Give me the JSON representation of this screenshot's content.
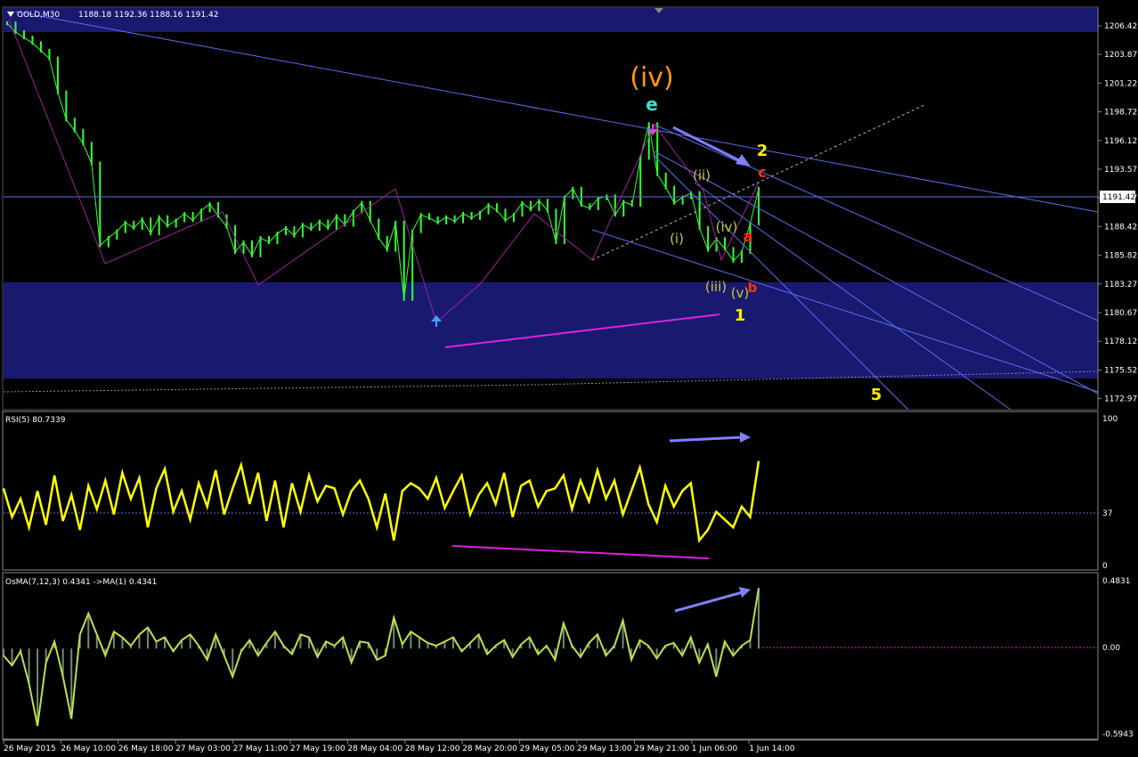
{
  "header": {
    "symbol": "GOLD,M30",
    "ohlc": "1188.18 1192.36 1188.16 1191.42"
  },
  "colors": {
    "background": "#000000",
    "zone": "#191970",
    "trendline": "#5a6cf0",
    "candle": "#33ff33",
    "rsi": "#ffff00",
    "osma_line": "#bfe04a",
    "osma_hist": "#6f8b73",
    "divergence": "#e020e0",
    "arrow": "#8080ff",
    "wave_orange": "#ff9900",
    "wave_cyan": "#40e0d0",
    "wave_olive": "#c8c83c",
    "wave_yellow": "#ffee00",
    "wave_red": "#ff3300"
  },
  "price_axis": {
    "labels": [
      "1206.42",
      "1203.87",
      "1201.22",
      "1198.72",
      "1196.12",
      "1193.57",
      "1190.97",
      "1188.42",
      "1185.82",
      "1183.27",
      "1180.67",
      "1178.12",
      "1175.52",
      "1172.97"
    ],
    "current": "1191.42"
  },
  "time_axis": {
    "labels": [
      "26 May 2015",
      "26 May 10:00",
      "26 May 18:00",
      "27 May 03:00",
      "27 May 11:00",
      "27 May 19:00",
      "28 May 04:00",
      "28 May 12:00",
      "28 May 20:00",
      "29 May 05:00",
      "29 May 13:00",
      "29 May 21:00",
      "1 Jun 06:00",
      "1 Jun 14:00"
    ]
  },
  "wave_labels": {
    "iv_major": "(iv)",
    "e": "e",
    "two": "2",
    "c": "c",
    "ii": "(ii)",
    "i": "(i)",
    "iv_minor": "(iv)",
    "a": "a",
    "iii": "(iii)",
    "v": "(v)",
    "b": "b",
    "one": "1",
    "five": "5"
  },
  "rsi": {
    "label": "RSI(5) 80.7339",
    "scale": [
      "100",
      "37",
      "0"
    ]
  },
  "osma": {
    "label": "OsMA(7,12,3) 0.4341  ->MA(1) 0.4341",
    "scale": [
      "0.4831",
      "0.00",
      "-0.5943"
    ]
  },
  "chart_data": [
    {
      "type": "line",
      "title": "GOLD,M30",
      "series": [
        {
          "name": "GOLD,M30",
          "values": [
            1206.8,
            1206.0,
            1205.5,
            1205.0,
            1204.3,
            1203.6,
            1200.5,
            1198.0,
            1197.0,
            1195.8,
            1194.0,
            1186.5,
            1187.2,
            1187.8,
            1188.6,
            1188.1,
            1188.9,
            1187.6,
            1189.1,
            1188.3,
            1188.8,
            1189.4,
            1188.8,
            1189.7,
            1190.3,
            1189.2,
            1188.2,
            1185.9,
            1186.8,
            1185.6,
            1187.2,
            1186.8,
            1187.6,
            1188.1,
            1187.4,
            1188.4,
            1188.0,
            1188.7,
            1188.1,
            1189.2,
            1188.4,
            1189.6,
            1190.4,
            1188.8,
            1187.2,
            1186.1,
            1188.6,
            1181.6,
            1187.8,
            1189.3,
            1189.0,
            1188.6,
            1189.1,
            1188.7,
            1189.4,
            1189.0,
            1189.5,
            1190.2,
            1189.7,
            1188.8,
            1189.3,
            1190.4,
            1189.8,
            1190.6,
            1189.7,
            1186.8,
            1190.9,
            1191.7,
            1190.2,
            1189.9,
            1190.8,
            1191.0,
            1189.3,
            1190.5,
            1190.2,
            1194.5,
            1197.6,
            1193.0,
            1191.8,
            1190.4,
            1190.9,
            1191.3,
            1188.1,
            1186.1,
            1187.1,
            1186.2,
            1185.1,
            1185.9,
            1188.5,
            1191.7
          ]
        }
      ],
      "ylabel": "",
      "ylim": [
        1171.5,
        1208.2
      ],
      "grid": false
    },
    {
      "type": "line",
      "title": "RSI(5) 80.7339",
      "series": [
        {
          "name": "RSI(5)",
          "values": [
            60,
            38,
            52,
            30,
            58,
            32,
            70,
            35,
            55,
            28,
            62,
            44,
            66,
            40,
            72,
            52,
            68,
            30,
            60,
            75,
            42,
            58,
            36,
            64,
            46,
            74,
            40,
            60,
            78,
            48,
            72,
            35,
            66,
            30,
            64,
            42,
            70,
            50,
            62,
            60,
            40,
            58,
            66,
            52,
            30,
            56,
            20,
            58,
            64,
            60,
            52,
            68,
            45,
            58,
            70,
            40,
            55,
            64,
            48,
            72,
            38,
            62,
            66,
            46,
            58,
            60,
            70,
            44,
            66,
            50,
            74,
            52,
            66,
            40,
            58,
            76,
            48,
            34,
            62,
            46,
            58,
            64,
            20,
            28,
            42,
            36,
            30,
            46,
            38,
            81
          ]
        }
      ],
      "ylim": [
        0,
        100
      ],
      "grid": false
    },
    {
      "type": "bar",
      "title": "OsMA(7,12,3) 0.4341  ->MA(1) 0.4341",
      "series": [
        {
          "name": "OsMA(7,12,3)",
          "values": [
            -0.05,
            -0.12,
            -0.02,
            -0.25,
            -0.55,
            -0.1,
            0.05,
            -0.2,
            -0.5,
            0.1,
            0.25,
            0.1,
            -0.05,
            0.12,
            0.08,
            0.02,
            0.1,
            0.15,
            0.05,
            0.08,
            -0.02,
            0.06,
            0.1,
            0.02,
            -0.08,
            0.1,
            -0.05,
            -0.2,
            -0.02,
            0.06,
            -0.05,
            0.04,
            0.12,
            0.02,
            -0.04,
            0.1,
            0.08,
            -0.06,
            0.05,
            0.02,
            0.08,
            -0.1,
            0.05,
            0.04,
            -0.08,
            -0.05,
            0.22,
            0.03,
            0.12,
            0.08,
            0.04,
            0.02,
            0.05,
            0.08,
            -0.02,
            0.04,
            0.1,
            -0.04,
            0.02,
            0.06,
            -0.06,
            0.03,
            0.08,
            -0.04,
            0.02,
            -0.08,
            0.18,
            0.02,
            -0.06,
            0.04,
            0.1,
            -0.05,
            0.02,
            0.2,
            -0.08,
            0.06,
            0.02,
            -0.07,
            0.02,
            0.04,
            -0.05,
            0.08,
            -0.1,
            0.03,
            -0.2,
            0.05,
            -0.05,
            0.02,
            0.06,
            0.43
          ]
        }
      ],
      "ylim": [
        -0.5943,
        0.4831
      ],
      "grid": false
    }
  ]
}
